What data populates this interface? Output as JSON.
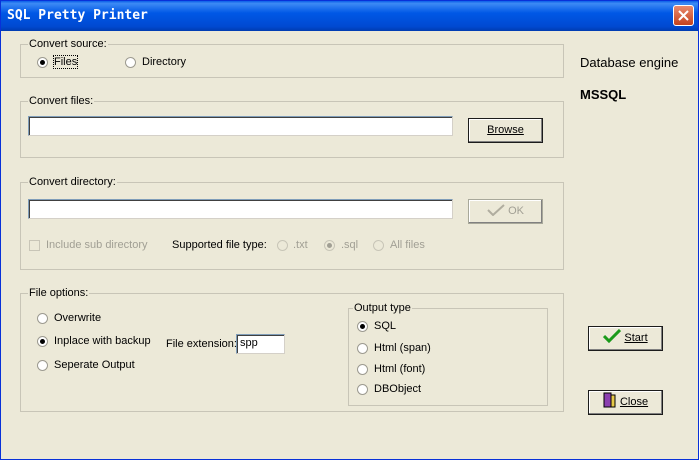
{
  "window": {
    "title": "SQL Pretty Printer"
  },
  "convert_source": {
    "legend": "Convert source:",
    "options": [
      {
        "label": "Files",
        "selected": true
      },
      {
        "label": "Directory",
        "selected": false
      }
    ]
  },
  "convert_files": {
    "legend": "Convert files:",
    "path_value": "",
    "browse_label": "Browse"
  },
  "convert_directory": {
    "legend": "Convert directory:",
    "path_value": "",
    "ok_label": "OK",
    "include_sub_label": "Include sub directory",
    "file_type_label": "Supported file type:",
    "file_types": [
      {
        "label": ".txt",
        "selected": false
      },
      {
        "label": ".sql",
        "selected": true
      },
      {
        "label": "All files",
        "selected": false
      }
    ]
  },
  "file_options": {
    "legend": "File options:",
    "options": [
      {
        "label": "Overwrite",
        "selected": false
      },
      {
        "label": "Inplace with backup",
        "selected": true
      },
      {
        "label": "Seperate Output",
        "selected": false
      }
    ],
    "extension_label": "File extension:",
    "extension_value": "spp",
    "output_type": {
      "legend": "Output type",
      "options": [
        {
          "label": "SQL",
          "selected": true
        },
        {
          "label": "Html (span)",
          "selected": false
        },
        {
          "label": "Html (font)",
          "selected": false
        },
        {
          "label": "DBObject",
          "selected": false
        }
      ]
    }
  },
  "engine": {
    "label": "Database engine",
    "value": "MSSQL"
  },
  "buttons": {
    "start_label": "Start",
    "close_label": "Close"
  },
  "colors": {
    "titlebar": "#0058e6",
    "background": "#ece9d8",
    "start_check": "#1a9a1a"
  }
}
